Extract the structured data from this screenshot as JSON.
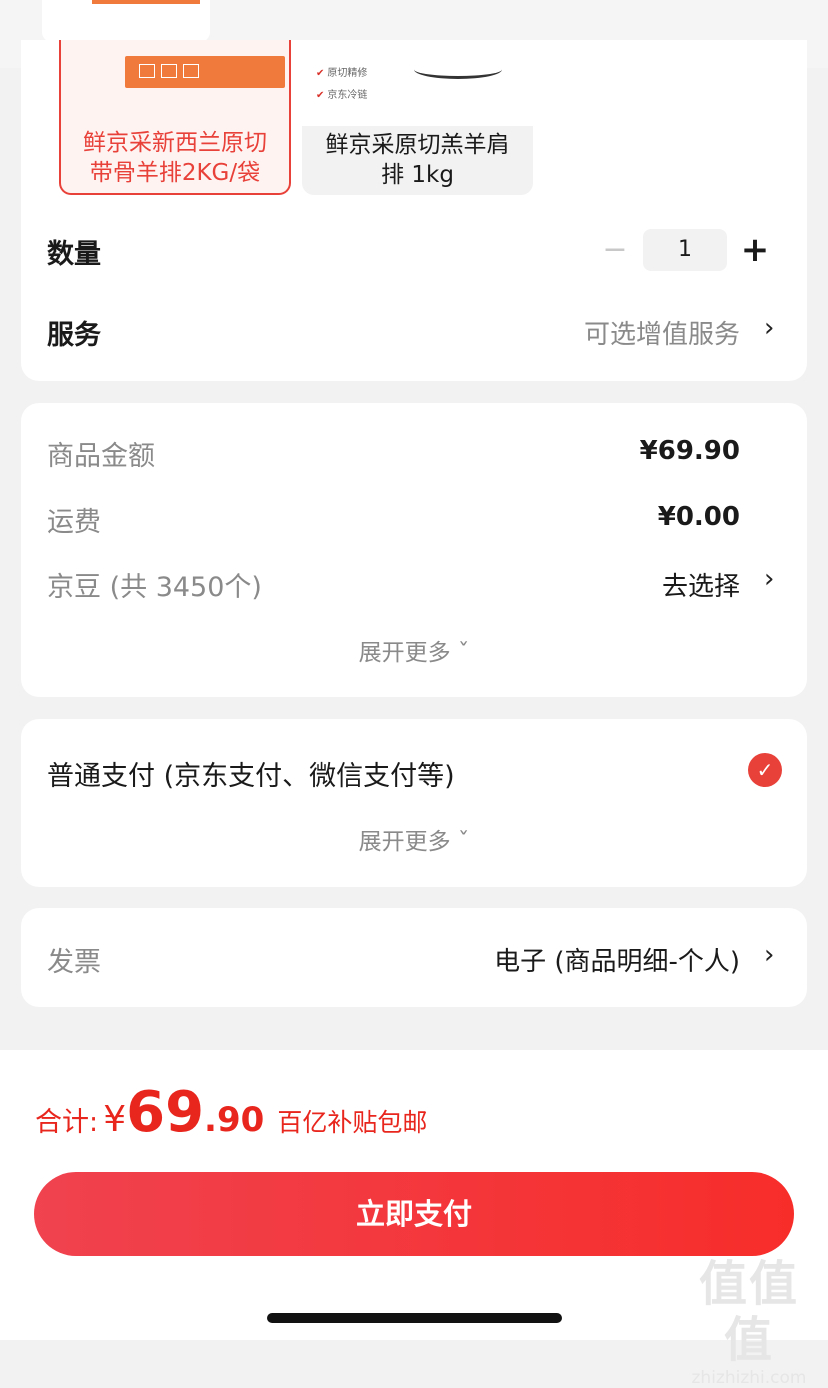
{
  "variants": [
    {
      "label_line1": "鲜京采新西兰原切",
      "label_line2": "带骨羊排2KG/袋",
      "selected": true
    },
    {
      "label_line1": "鲜京采原切羔羊肩",
      "label_line2": "排 1kg",
      "selected": false,
      "image_checks": [
        "原切精修",
        "京东冷链"
      ]
    }
  ],
  "quantity": {
    "label": "数量",
    "minus": "−",
    "value": "1",
    "plus": "+"
  },
  "service": {
    "label": "服务",
    "value": "可选增值服务",
    "chevron": "›"
  },
  "summary": {
    "goods_amount": {
      "label": "商品金额",
      "value": "¥69.90"
    },
    "shipping": {
      "label": "运费",
      "value": "¥0.00"
    },
    "jingdou": {
      "label": "京豆 (共 3450个)",
      "value": "去选择",
      "chevron": "›"
    },
    "expand": "展开更多 ˇ"
  },
  "payment": {
    "label": "普通支付 (京东支付、微信支付等)",
    "check": "✓",
    "expand": "展开更多 ˇ"
  },
  "invoice": {
    "label": "发票",
    "value": "电子 (商品明细-个人)",
    "chevron": "›"
  },
  "total": {
    "label": "合计:",
    "currency": "¥",
    "integer": "69",
    "decimal": ".90",
    "note": "百亿补贴包邮"
  },
  "pay_button": "立即支付",
  "watermark": {
    "big": "值值值",
    "small": "zhizhizhi.com"
  },
  "colors": {
    "accent": "#e8413a",
    "price": "#e8261e"
  }
}
